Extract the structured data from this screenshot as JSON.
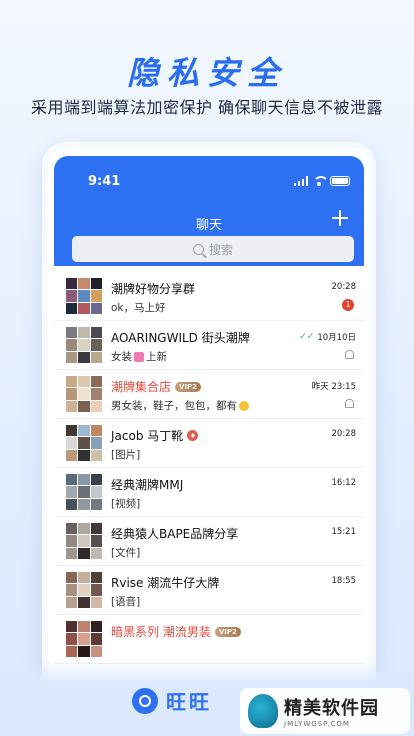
{
  "promo": {
    "headline": "隐私安全",
    "subline": "采用端到端算法加密保护 确保聊天信息不被泄露"
  },
  "phone": {
    "status_time": "9:41",
    "header_title": "聊天",
    "search_placeholder": "搜索"
  },
  "chats": [
    {
      "name": "潮牌好物分享群",
      "message": "ok，马上好",
      "time": "20:28",
      "badge": "1",
      "name_red": false
    },
    {
      "name": "AOARINGWILD 街头潮牌",
      "message_prefix": "女装",
      "message_suffix": "上新",
      "time": "10月10日",
      "name_red": false
    },
    {
      "name": "潮牌集合店",
      "vip": "VIP2",
      "message": "男女装，鞋子，包包，都有",
      "time": "昨天 23:15",
      "name_red": true
    },
    {
      "name": "Jacob 马丁靴",
      "message": "[图片]",
      "time": "20:28",
      "name_red": false
    },
    {
      "name": "经典潮牌MMJ",
      "message": "[视频]",
      "time": "16:12",
      "name_red": false
    },
    {
      "name": "经典猿人BAPE品牌分享",
      "message": "[文件]",
      "time": "15:21",
      "name_red": false
    },
    {
      "name": "Rvise 潮流牛仔大牌",
      "message": "[语音]",
      "time": "18:55",
      "name_red": false
    },
    {
      "name": "暗黑系列 潮流男装",
      "vip": "VIP2",
      "message": "",
      "time": "",
      "name_red": true
    }
  ],
  "brand": {
    "name": "旺旺"
  },
  "watermark": {
    "main": "精美软件园",
    "sub": "JMLYWGSP.COM"
  },
  "colors": {
    "accent": "#2d71f2",
    "danger": "#e5412f",
    "vip": "#b8875f"
  }
}
